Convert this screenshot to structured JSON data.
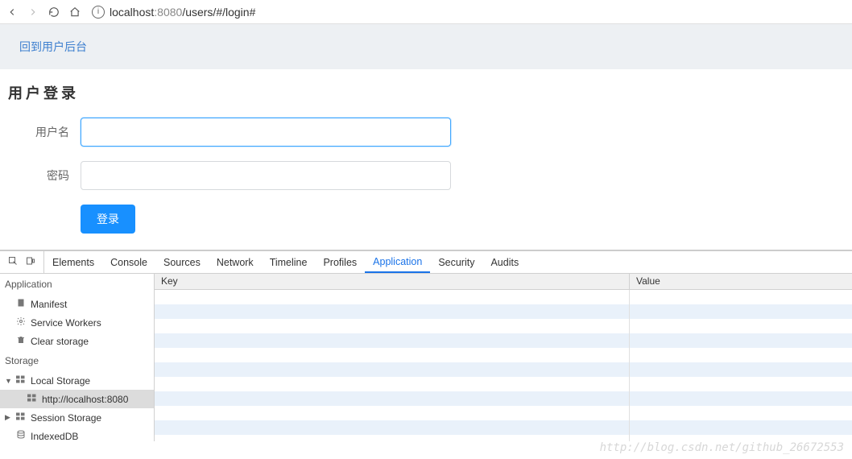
{
  "browser": {
    "url_prefix": "localhost",
    "url_port": ":8080",
    "url_path": "/users/#/login#"
  },
  "page": {
    "banner_link": "回到用户后台",
    "title": "用户登录",
    "form": {
      "username_label": "用户名",
      "username_value": "",
      "password_label": "密码",
      "password_value": "",
      "submit_label": "登录"
    }
  },
  "devtools": {
    "tabs": [
      "Elements",
      "Console",
      "Sources",
      "Network",
      "Timeline",
      "Profiles",
      "Application",
      "Security",
      "Audits"
    ],
    "active_tab": "Application",
    "sidebar": {
      "sections": [
        {
          "title": "Application",
          "items": [
            {
              "icon": "manifest-icon",
              "label": "Manifest"
            },
            {
              "icon": "gear-icon",
              "label": "Service Workers"
            },
            {
              "icon": "trash-icon",
              "label": "Clear storage"
            }
          ]
        },
        {
          "title": "Storage",
          "items": [
            {
              "icon": "db-icon",
              "label": "Local Storage",
              "expandable": true,
              "expanded": true,
              "children": [
                {
                  "icon": "db-icon",
                  "label": "http://localhost:8080",
                  "selected": true
                }
              ]
            },
            {
              "icon": "db-icon",
              "label": "Session Storage",
              "expandable": true,
              "expanded": false
            },
            {
              "icon": "db-stack-icon",
              "label": "IndexedDB"
            }
          ]
        }
      ]
    },
    "table": {
      "headers": {
        "key": "Key",
        "value": "Value"
      },
      "rows": []
    }
  },
  "watermark": "http://blog.csdn.net/github_26672553"
}
